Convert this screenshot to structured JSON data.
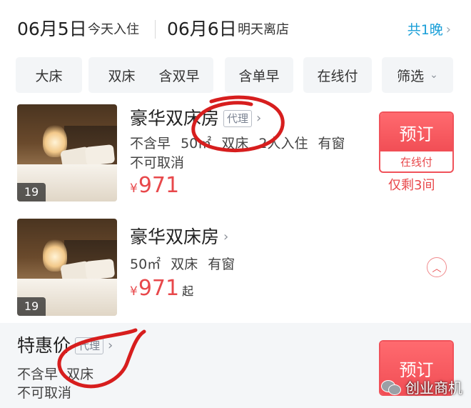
{
  "stay": {
    "checkin_date": "06月5日",
    "checkin_label": "今天入住",
    "checkout_date": "06月6日",
    "checkout_label": "明天离店",
    "nights_label": "共1晚"
  },
  "filters": [
    {
      "label": "大床"
    },
    {
      "label": "双床"
    },
    {
      "label": "含双早"
    },
    {
      "label": "含单早"
    },
    {
      "label": "在线付"
    },
    {
      "label": "筛选"
    }
  ],
  "rooms": [
    {
      "title": "豪华双床房",
      "tag": "代理",
      "photo_count": "19",
      "info": [
        "不含早",
        "50㎡",
        "双床",
        "2人入住",
        "有窗"
      ],
      "cancel_policy": "不可取消",
      "currency": "¥",
      "price": "971",
      "book_label": "预订",
      "pay_label": "在线付",
      "remaining": "仅剩3间"
    },
    {
      "title": "豪华双床房",
      "photo_count": "19",
      "info": [
        "50㎡",
        "双床",
        "有窗"
      ],
      "currency": "¥",
      "price": "971",
      "price_suffix": "起"
    }
  ],
  "offer": {
    "title": "特惠价",
    "tag": "代理",
    "info": [
      "不含早",
      "双床"
    ],
    "cancel_policy": "不可取消",
    "book_label": "预订"
  },
  "watermark": {
    "text": "创业商机"
  },
  "colors": {
    "accent_red": "#e8484b",
    "link_blue": "#1a9fd8",
    "annotation_red": "#d71e1e"
  }
}
